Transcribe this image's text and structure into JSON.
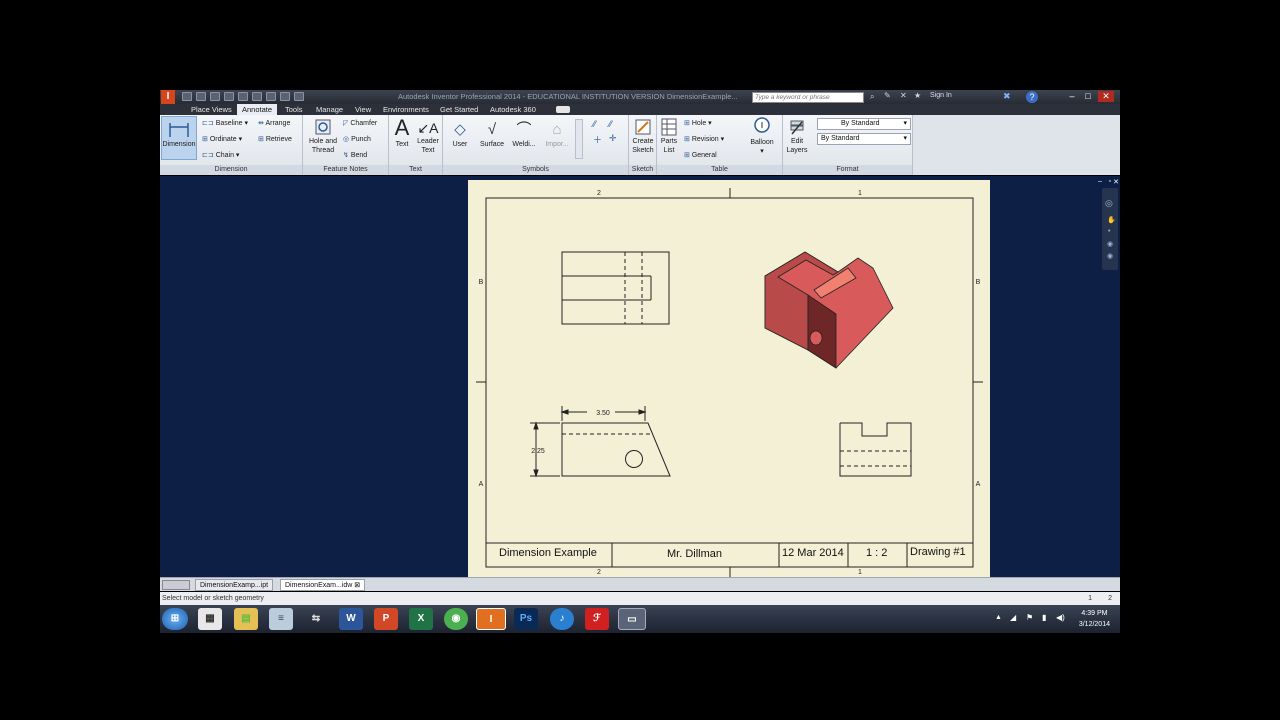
{
  "app": {
    "title": "Autodesk Inventor Professional 2014 - EDUCATIONAL INSTITUTION VERSION   DimensionExample...",
    "search_placeholder": "Type a keyword or phrase",
    "sign_in": "Sign In"
  },
  "tabs": [
    "Place Views",
    "Annotate",
    "Tools",
    "Manage",
    "View",
    "Environments",
    "Get Started",
    "Autodesk 360"
  ],
  "active_tab": "Annotate",
  "ribbon": {
    "dimension": {
      "label": "Dimension",
      "big": "Dimension",
      "baseline": "Baseline",
      "ordinate": "Ordinate",
      "chain": "Chain",
      "arrange": "Arrange",
      "retrieve": "Retrieve"
    },
    "feature_notes": {
      "label": "Feature Notes",
      "hole_thread_1": "Hole and",
      "hole_thread_2": "Thread",
      "chamfer": "Chamfer",
      "punch": "Punch",
      "bend": "Bend"
    },
    "text": {
      "label": "Text",
      "text": "Text",
      "leader_1": "Leader",
      "leader_2": "Text"
    },
    "symbols": {
      "label": "Symbols",
      "user": "User",
      "surface": "Surface",
      "welding": "Weldi...",
      "import": "Impor..."
    },
    "sketch": {
      "label": "Sketch",
      "create_1": "Create",
      "create_2": "Sketch"
    },
    "table": {
      "label": "Table",
      "parts_1": "Parts",
      "parts_2": "List",
      "hole": "Hole",
      "revision": "Revision",
      "general": "General",
      "balloon": "Balloon"
    },
    "format": {
      "label": "Format",
      "edit_1": "Edit",
      "edit_2": "Layers",
      "style1": "By Standard",
      "style2": "By Standard"
    }
  },
  "drawing": {
    "zones_top": [
      "2",
      "1"
    ],
    "zones_bottom": [
      "2",
      "1"
    ],
    "zones_left": [
      "B",
      "A"
    ],
    "zones_right": [
      "B",
      "A"
    ],
    "dim_horizontal": "3.50",
    "dim_vertical": "2.25",
    "title_block": {
      "title": "Dimension Example",
      "author": "Mr. Dillman",
      "date": "12 Mar 2014",
      "scale": "1 : 2",
      "drawing": "Drawing #1"
    },
    "part_color": "#d85a5a"
  },
  "doc_tabs": [
    "DimensionExamp...ipt",
    "DimensionExam...idw"
  ],
  "active_doc": "DimensionExam...idw",
  "status": {
    "message": "Select model or sketch geometry",
    "right1": "1",
    "right2": "2"
  },
  "taskbar": {
    "time": "4:39 PM",
    "date": "3/12/2014"
  }
}
